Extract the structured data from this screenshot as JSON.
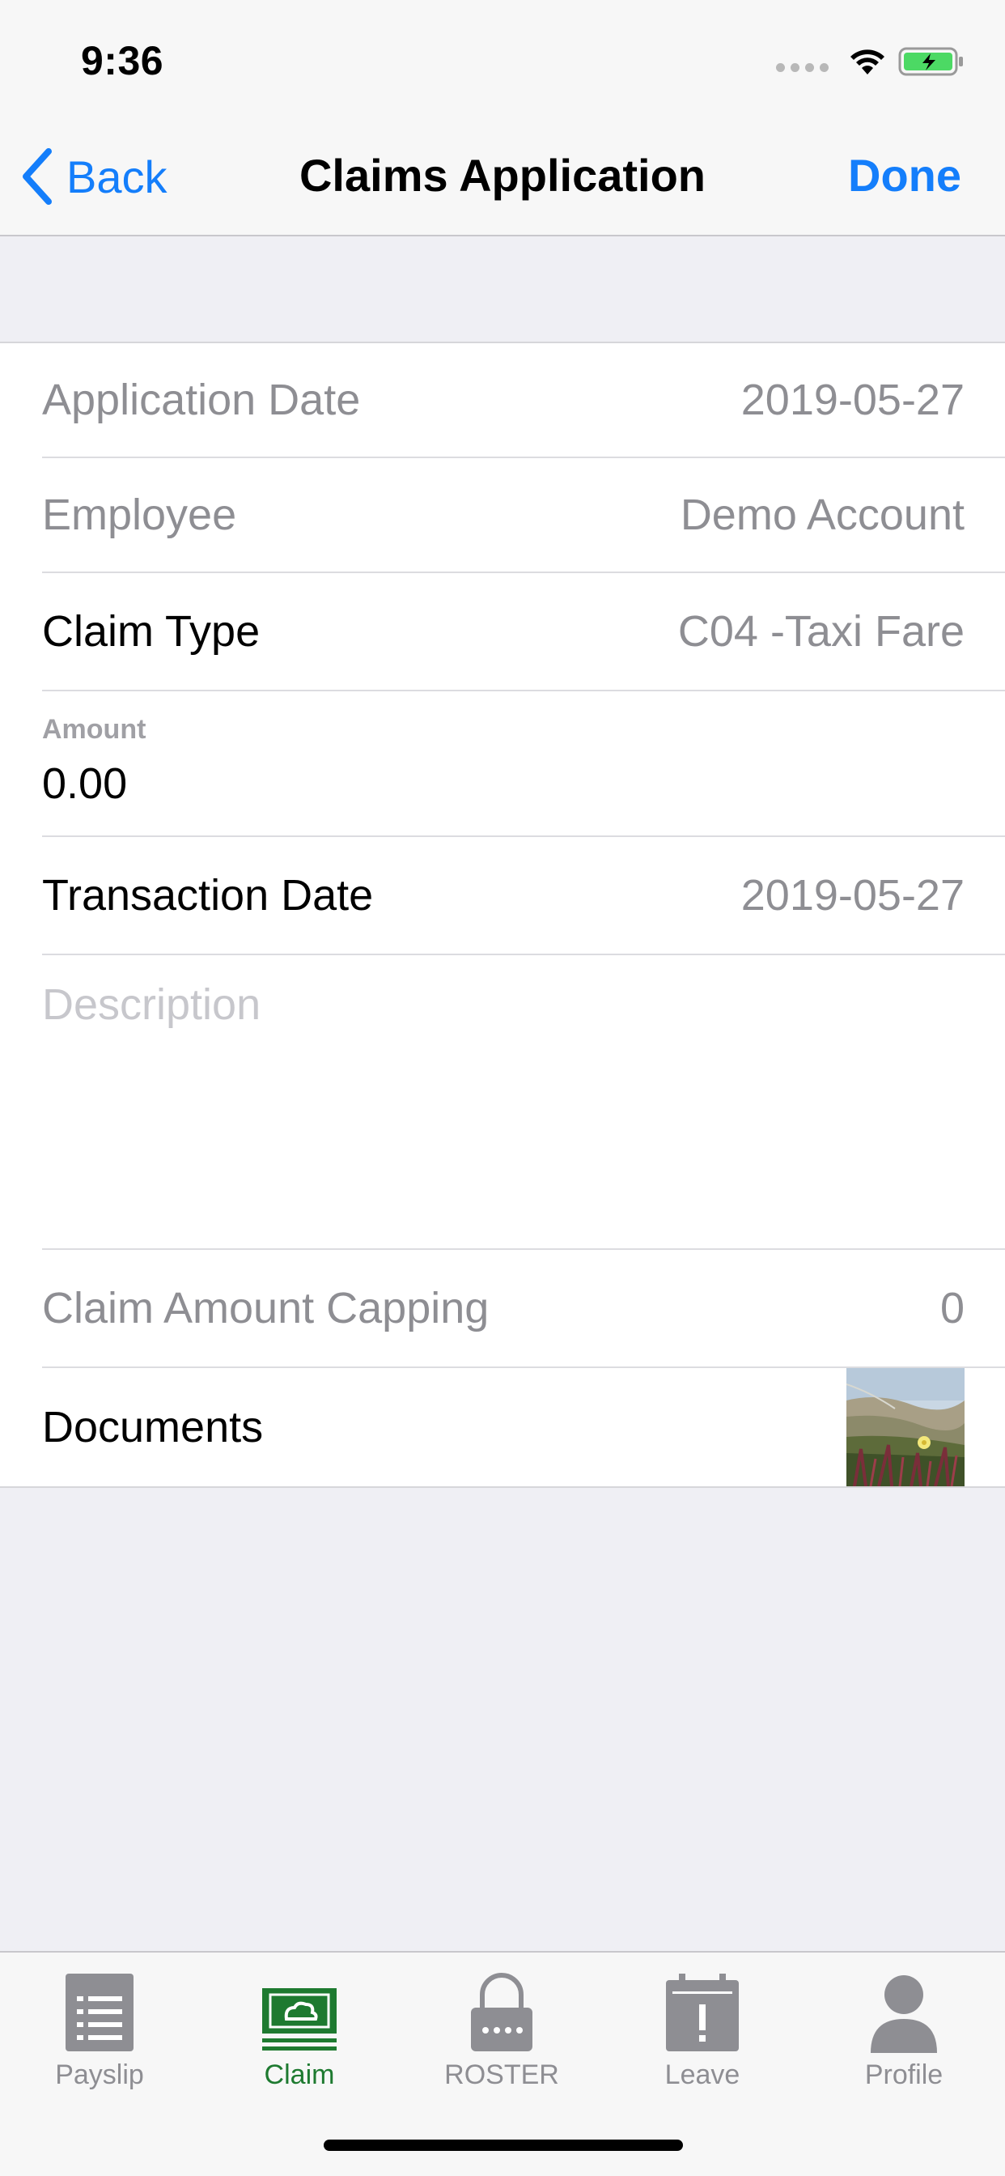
{
  "status": {
    "time": "9:36"
  },
  "nav": {
    "back_label": "Back",
    "title": "Claims Application",
    "done_label": "Done"
  },
  "form": {
    "application_date": {
      "label": "Application Date",
      "value": "2019-05-27"
    },
    "employee": {
      "label": "Employee",
      "value": "Demo Account"
    },
    "claim_type": {
      "label": "Claim Type",
      "value": "C04 -Taxi Fare"
    },
    "amount": {
      "label": "Amount",
      "value": "0.00"
    },
    "transaction_date": {
      "label": "Transaction Date",
      "value": "2019-05-27"
    },
    "description": {
      "placeholder": "Description"
    },
    "capping": {
      "label": "Claim Amount Capping",
      "value": "0"
    },
    "documents": {
      "label": "Documents"
    }
  },
  "tabbar": {
    "tabs": [
      {
        "label": "Payslip",
        "icon": "payslip-icon"
      },
      {
        "label": "Claim",
        "icon": "claim-icon",
        "active": true
      },
      {
        "label": "ROSTER",
        "icon": "roster-icon"
      },
      {
        "label": "Leave",
        "icon": "leave-icon"
      },
      {
        "label": "Profile",
        "icon": "profile-icon"
      }
    ]
  },
  "colors": {
    "accent": "#147efb",
    "active_tab": "#1e7a30",
    "inactive_tab": "#8e8e93"
  }
}
